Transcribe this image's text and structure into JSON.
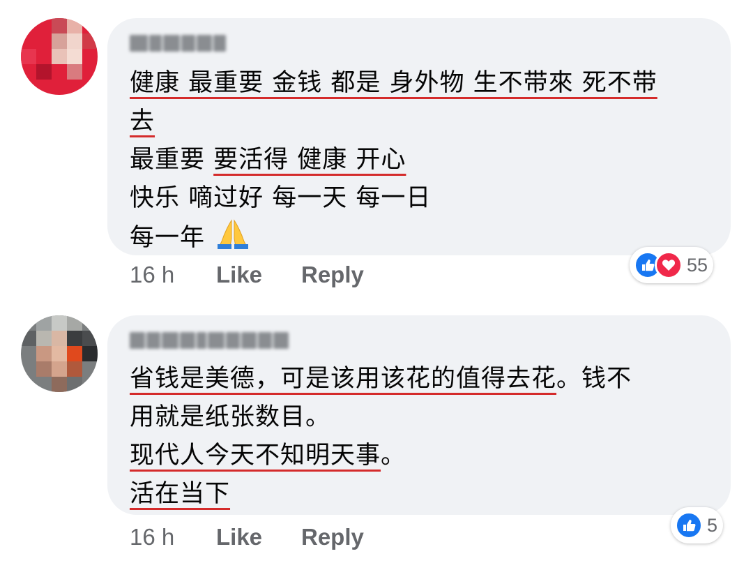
{
  "comments": [
    {
      "lines": [
        [
          {
            "t": "健康 最重要  金钱 都是 身外物 生不带來 死不带",
            "u": true
          }
        ],
        [
          {
            "t": "去",
            "u": true
          }
        ],
        [
          {
            "t": "最重要 ",
            "u": false
          },
          {
            "t": "要活得 健康 开心",
            "u": true
          }
        ],
        [
          {
            "t": "快乐 嘀过好 每一天 每一日",
            "u": false
          }
        ],
        [
          {
            "t": "每一年 ",
            "u": false
          }
        ]
      ],
      "emoji_icon": "folded-hands-emoji",
      "time": "16 h",
      "like_label": "Like",
      "reply_label": "Reply",
      "reactions": [
        "like",
        "love"
      ],
      "reaction_count": "55"
    },
    {
      "lines": [
        [
          {
            "t": "省钱是美德，可是该用该花的值得去花",
            "u": true
          },
          {
            "t": "。钱不",
            "u": false
          }
        ],
        [
          {
            "t": "用就是纸张数目。",
            "u": false
          }
        ],
        [
          {
            "t": "现代人今天不知明天事",
            "u": true
          },
          {
            "t": "。",
            "u": false
          }
        ],
        [
          {
            "t": "活在当下",
            "u": true
          }
        ]
      ],
      "time": "16 h",
      "like_label": "Like",
      "reply_label": "Reply",
      "reactions": [
        "like"
      ],
      "reaction_count": "5"
    }
  ],
  "colors": {
    "bubble": "#f0f2f5",
    "underline": "#d42b2b",
    "meta_text": "#65676b",
    "like_blue": "#1877f2",
    "love_red": "#f0284a"
  }
}
